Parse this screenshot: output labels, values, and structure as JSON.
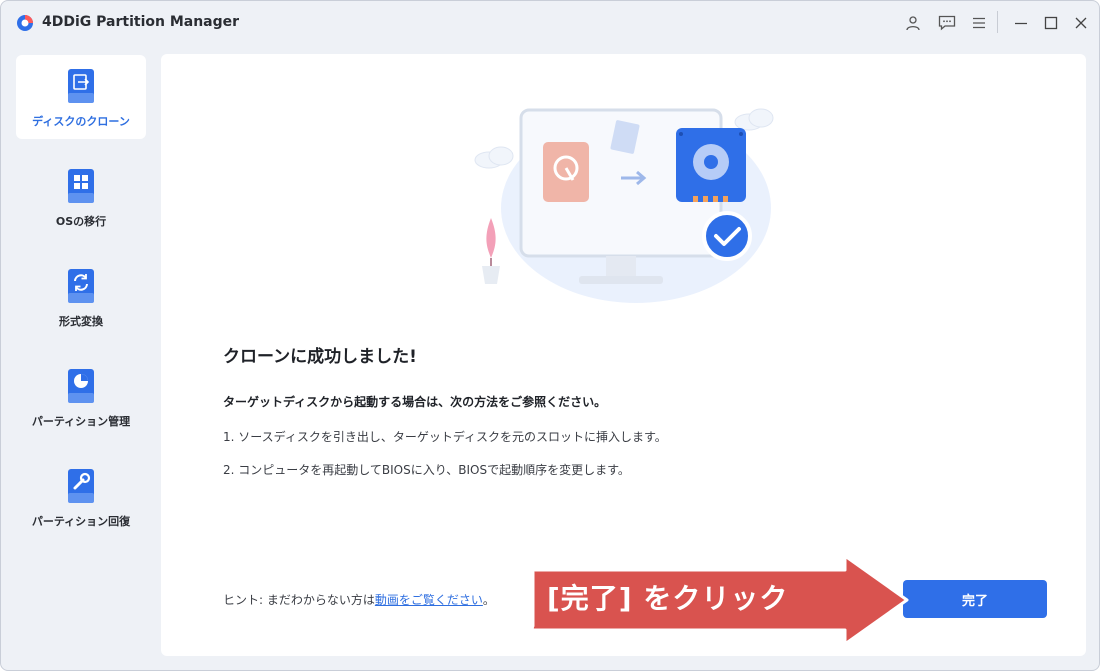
{
  "app": {
    "title": "4DDiG Partition Manager"
  },
  "titlebar": {
    "icons": [
      "account-icon",
      "feedback-icon",
      "menu-icon",
      "minimize-icon",
      "maximize-icon",
      "close-icon"
    ]
  },
  "sidebar": {
    "items": [
      {
        "label": "ディスクのクローン",
        "icon": "disk-clone-icon",
        "active": true
      },
      {
        "label": "OSの移行",
        "icon": "os-migration-icon",
        "active": false
      },
      {
        "label": "形式変換",
        "icon": "format-convert-icon",
        "active": false
      },
      {
        "label": "パーティション管理",
        "icon": "partition-manage-icon",
        "active": false
      },
      {
        "label": "パーティション回復",
        "icon": "partition-recovery-icon",
        "active": false
      }
    ]
  },
  "main": {
    "success_title": "クローンに成功しました!",
    "instructions_title": "ターゲットディスクから起動する場合は、次の方法をご参照ください。",
    "steps": [
      "1. ソースディスクを引き出し、ターゲットディスクを元のスロットに挿入します。",
      "2. コンピュータを再起動してBIOSに入り、BIOSで起動順序を変更します。"
    ],
    "hint": {
      "prefix": "ヒント: まだわからない方は",
      "link": "動画をご覧ください",
      "suffix": "。"
    },
    "finish_button": "完了"
  },
  "annotation": {
    "text": "[完了] をクリック"
  },
  "colors": {
    "accent": "#2f6fe8",
    "sidebar_bg": "#eef1f6",
    "callout": "#d9534f"
  }
}
